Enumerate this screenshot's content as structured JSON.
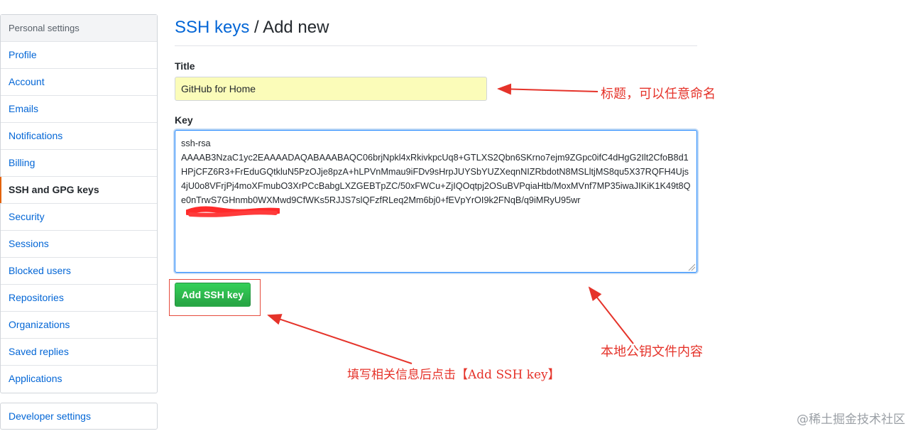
{
  "sidebar": {
    "header": "Personal settings",
    "items": [
      {
        "label": "Profile"
      },
      {
        "label": "Account"
      },
      {
        "label": "Emails"
      },
      {
        "label": "Notifications"
      },
      {
        "label": "Billing"
      },
      {
        "label": "SSH and GPG keys",
        "selected": true
      },
      {
        "label": "Security"
      },
      {
        "label": "Sessions"
      },
      {
        "label": "Blocked users"
      },
      {
        "label": "Repositories"
      },
      {
        "label": "Organizations"
      },
      {
        "label": "Saved replies"
      },
      {
        "label": "Applications"
      }
    ],
    "developer_settings": "Developer settings"
  },
  "main": {
    "breadcrumb_link": "SSH keys",
    "breadcrumb_sep": " / ",
    "breadcrumb_current": "Add new",
    "title_label": "Title",
    "title_value": "GitHub for Home",
    "key_label": "Key",
    "key_prefix": "ssh-rsa",
    "key_body": "AAAAB3NzaC1yc2EAAAADAQABAAABAQC06brjNpkl4xRkivkpcUq8+GTLXS2Qbn6SKrno7ejm9ZGpc0ifC4dHgG2Ilt2CfoB8d1HPjCFZ6R3+FrEduGQtkluN5PzOJje8pzA+hLPVnMmau9iFDv9sHrpJUYSbYUZXeqnNIZRbdotN8MSLltjMS8qu5X37RQFH4Ujs4jU0o8VFrjPj4moXFmubO3XrPCcBabgLXZGEBTpZC/50xFWCu+ZjIQOqtpj2OSuBVPqiaHtb/MoxMVnf7MP35iwaJIKiK1K49t8Qe0nTrwS7GHnmb0WXMwd9CfWKs5RJJS7slQFzfRLeq2Mm6bj0+fEVpYrOI9k2FNqB/q9iMRyU95wr",
    "add_button": "Add SSH key"
  },
  "annotations": {
    "title_note": "标题，可以任意命名",
    "key_note": "本地公钥文件内容",
    "click_note": "填写相关信息后点击【Add SSH key】"
  },
  "watermark": "@稀土掘金技术社区",
  "colors": {
    "link": "#0366d6",
    "button_green": "#28a745",
    "annotation_red": "#e5332a",
    "title_input_bg": "#fbfcb9",
    "selected_accent": "#e36209"
  }
}
